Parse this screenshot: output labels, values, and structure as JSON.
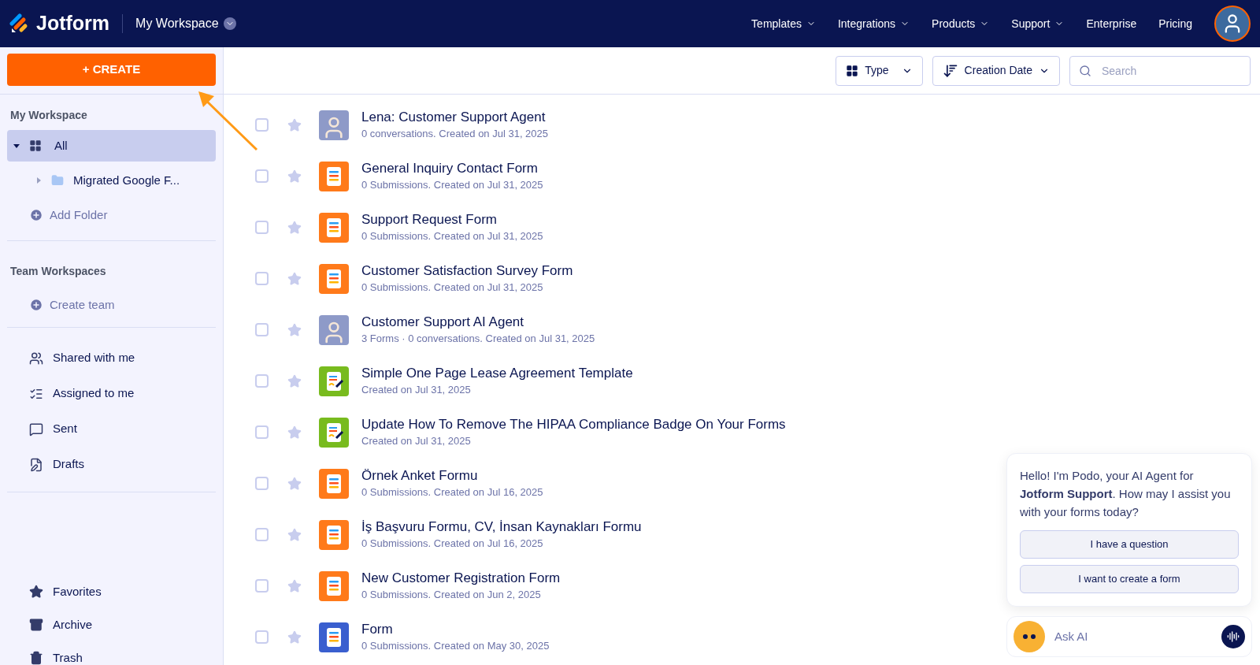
{
  "header": {
    "logo": "Jotform",
    "workspace": "My Workspace",
    "nav": [
      {
        "label": "Templates",
        "dropdown": true
      },
      {
        "label": "Integrations",
        "dropdown": true
      },
      {
        "label": "Products",
        "dropdown": true
      },
      {
        "label": "Support",
        "dropdown": true
      },
      {
        "label": "Enterprise",
        "dropdown": false
      },
      {
        "label": "Pricing",
        "dropdown": false
      }
    ]
  },
  "sidebar": {
    "create_button": "+ CREATE",
    "workspace_heading": "My Workspace",
    "tree": [
      {
        "label": "All",
        "selected": true,
        "expanded": true,
        "children": [
          {
            "label": "Migrated Google F...",
            "selected": false,
            "expanded": false
          }
        ]
      }
    ],
    "add_folder": "Add Folder",
    "team_heading": "Team Workspaces",
    "create_team": "Create team",
    "links": [
      "Shared with me",
      "Assigned to me",
      "Sent",
      "Drafts"
    ],
    "bottom_links": [
      "Favorites",
      "Archive",
      "Trash"
    ]
  },
  "toolbar": {
    "type_filter": "Type",
    "sort": "Creation Date",
    "search_placeholder": "Search"
  },
  "items": [
    {
      "kind": "agent",
      "title": "Lena: Customer Support Agent",
      "meta": "0 conversations. Created on Jul 31, 2025",
      "checked": false,
      "starred": false
    },
    {
      "kind": "form",
      "title": "General Inquiry Contact Form",
      "meta": "0 Submissions. Created on Jul 31, 2025",
      "checked": false,
      "starred": false
    },
    {
      "kind": "form",
      "title": "Support Request Form",
      "meta": "0 Submissions. Created on Jul 31, 2025",
      "checked": false,
      "starred": false
    },
    {
      "kind": "form",
      "title": "Customer Satisfaction Survey Form",
      "meta": "0 Submissions. Created on Jul 31, 2025",
      "checked": false,
      "starred": false
    },
    {
      "kind": "agent",
      "title": "Customer Support AI Agent",
      "meta": "3 Forms · 0 conversations. Created on Jul 31, 2025",
      "checked": false,
      "starred": false
    },
    {
      "kind": "document",
      "title": "Simple One Page Lease Agreement Template",
      "meta": "Created on Jul 31, 2025",
      "checked": false,
      "starred": false
    },
    {
      "kind": "document",
      "title": "Update How To Remove The HIPAA Compliance Badge On Your Forms",
      "meta": "Created on Jul 31, 2025",
      "checked": false,
      "starred": false
    },
    {
      "kind": "form",
      "title": "Örnek Anket Formu",
      "meta": "0 Submissions. Created on Jul 16, 2025",
      "checked": false,
      "starred": false
    },
    {
      "kind": "form",
      "title": "İş Başvuru Formu, CV, İnsan Kaynakları Formu",
      "meta": "0 Submissions. Created on Jul 16, 2025",
      "checked": false,
      "starred": false
    },
    {
      "kind": "form",
      "title": "New Customer Registration Form",
      "meta": "0 Submissions. Created on Jun 2, 2025",
      "checked": false,
      "starred": false
    },
    {
      "kind": "card_form",
      "title": "Form",
      "meta": "0 Submissions. Created on May 30, 2025",
      "checked": false,
      "starred": false
    }
  ],
  "chat": {
    "message": "Hello! I'm Podo, your AI Agent for **Jotform Support**. How may I assist you with your forms today?",
    "options": [
      "I have a question",
      "I want to create a form"
    ],
    "input_placeholder": "Ask AI"
  }
}
